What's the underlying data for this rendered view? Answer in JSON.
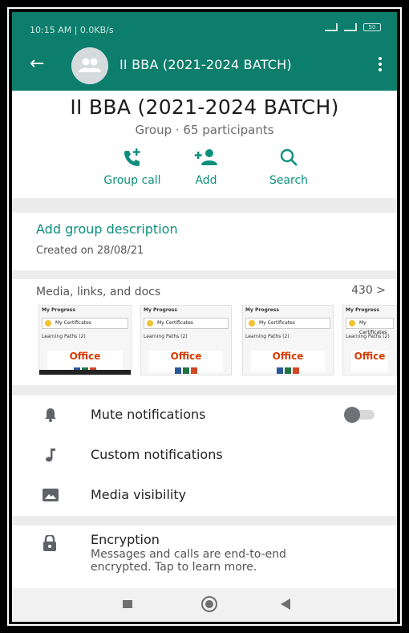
{
  "status_bar": {
    "time_speed": "10:15 AM | 0.0KB/s",
    "battery": "50"
  },
  "app_bar": {
    "title": "II BBA (2021-2024 BATCH)",
    "back_icon": "arrow-left-icon",
    "menu_icon": "more-vert-icon"
  },
  "header": {
    "group_name": "II BBA (2021-2024 BATCH)",
    "subtitle": "Group · 65 participants"
  },
  "actions": [
    {
      "label": "Group call",
      "icon": "add-call-icon"
    },
    {
      "label": "Add",
      "icon": "person-add-icon"
    },
    {
      "label": "Search",
      "icon": "search-icon"
    }
  ],
  "description": {
    "link": "Add group description",
    "created": "Created on 28/08/21"
  },
  "media": {
    "title": "Media, links, and docs",
    "count": "430 >",
    "thumb_text": {
      "progress": "My Progress",
      "certificates": "My Certificates",
      "paths": "Learning Paths (2)",
      "office": "Office"
    }
  },
  "settings": [
    {
      "label": "Mute notifications",
      "icon": "bell-icon",
      "toggle": false
    },
    {
      "label": "Custom notifications",
      "icon": "music-note-icon"
    },
    {
      "label": "Media visibility",
      "icon": "image-icon"
    }
  ],
  "encryption": {
    "title": "Encryption",
    "subtitle": "Messages and calls are end-to-end encrypted. Tap to learn more.",
    "icon": "lock-icon"
  },
  "colors": {
    "brand": "#0d7d6c",
    "accent": "#0b8f7c"
  }
}
